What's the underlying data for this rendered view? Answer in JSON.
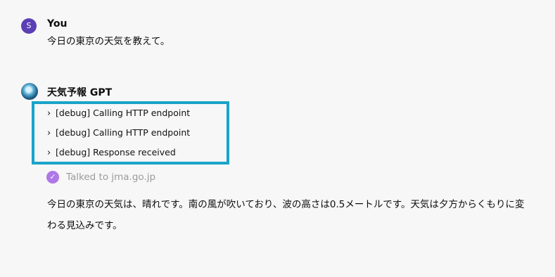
{
  "user_message": {
    "avatar_letter": "S",
    "author": "You",
    "text": "今日の東京の天気を教えて。"
  },
  "gpt_message": {
    "author": "天気予報 GPT",
    "debug_items": [
      "[debug] Calling HTTP endpoint",
      "[debug] Calling HTTP endpoint",
      "[debug] Response received"
    ],
    "tool_status": "Talked to jma.go.jp",
    "answer_line1": "今日の東京の天気は、晴れです。南の風が吹いており、波の高さは0.5メートルです。天気は夕方からくもりに変",
    "answer_line2": "わる見込みです。"
  },
  "colors": {
    "highlight_border": "#1aa3c9",
    "user_avatar": "#5b3fb5",
    "check_badge": "#ae78e6"
  }
}
